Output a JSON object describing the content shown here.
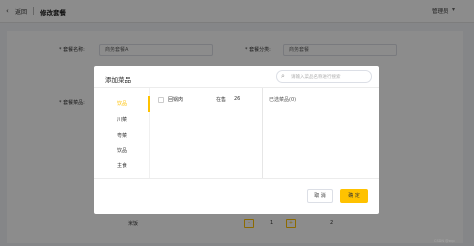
{
  "header": {
    "back_icon": "‹",
    "back_label": "返回",
    "page_title": "修改套餐",
    "user_name": "管理员",
    "user_caret": "▾"
  },
  "form": {
    "name_label": "* 套餐名称:",
    "name_value": "商务套餐A",
    "category_label": "* 套餐分类:",
    "category_value": "商务套餐",
    "dishes_label": "* 套餐菜品:"
  },
  "bg_table": {
    "row_label": "米饭",
    "pager": {
      "prev": "-",
      "count": "1",
      "next": "+"
    },
    "price": "2"
  },
  "dialog": {
    "title": "添加菜品",
    "search_placeholder": "请输入菜品名称进行搜索",
    "search_icon": "⌕",
    "categories": [
      {
        "label": "饮品",
        "active": true
      },
      {
        "label": "川菜",
        "active": false
      },
      {
        "label": "粤菜",
        "active": false
      },
      {
        "label": "饮品",
        "active": false
      },
      {
        "label": "主食",
        "active": false
      }
    ],
    "dishes": [
      {
        "name": "回锅肉",
        "status": "在售",
        "price": "26"
      }
    ],
    "selected_title": "已选菜品(0)",
    "cancel_label": "取 消",
    "confirm_label": "确 定"
  },
  "watermark": "CSDN @zcp",
  "colors": {
    "accent": "#ffc200",
    "overlay": "rgba(0,0,0,0.45)"
  }
}
